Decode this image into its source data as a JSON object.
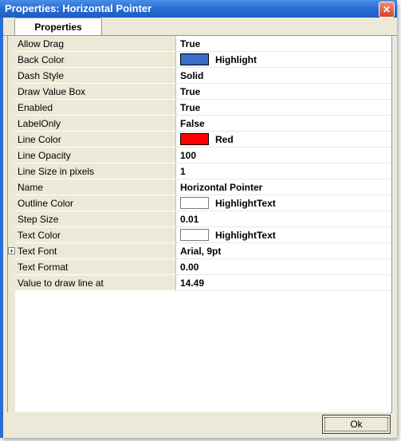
{
  "window": {
    "title": "Properties: Horizontal Pointer",
    "close_glyph": "✕"
  },
  "tabs": [
    {
      "label": "Properties"
    }
  ],
  "properties": [
    {
      "name": "Allow Drag",
      "value": "True"
    },
    {
      "name": "Back Color",
      "value": "Highlight",
      "swatch": "#3a6cc8"
    },
    {
      "name": "Dash Style",
      "value": "Solid"
    },
    {
      "name": "Draw Value Box",
      "value": "True"
    },
    {
      "name": "Enabled",
      "value": "True"
    },
    {
      "name": "LabelOnly",
      "value": "False"
    },
    {
      "name": "Line Color",
      "value": "Red",
      "swatch": "#ff0000"
    },
    {
      "name": "Line Opacity",
      "value": "100"
    },
    {
      "name": "Line Size in pixels",
      "value": "1"
    },
    {
      "name": "Name",
      "value": "Horizontal Pointer"
    },
    {
      "name": "Outline Color",
      "value": "HighlightText",
      "swatch": "#ffffff"
    },
    {
      "name": "Step Size",
      "value": "0.01"
    },
    {
      "name": "Text Color",
      "value": "HighlightText",
      "swatch": "#ffffff"
    },
    {
      "name": "Text Font",
      "value": "Arial, 9pt",
      "expandable": true,
      "expander_glyph": "+"
    },
    {
      "name": "Text Format",
      "value": "0.00"
    },
    {
      "name": "Value to draw line at",
      "value": "14.49"
    }
  ],
  "buttons": {
    "ok_label": "Ok"
  }
}
